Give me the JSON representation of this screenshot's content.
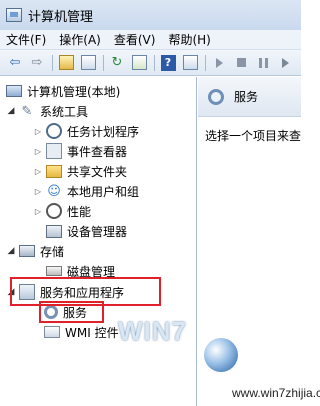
{
  "window": {
    "title": "计算机管理"
  },
  "menu": [
    "文件(F)",
    "操作(A)",
    "查看(V)",
    "帮助(H)"
  ],
  "toolbar": {
    "back": "⇦",
    "forward": "⇨",
    "refresh": "↻",
    "help": "?"
  },
  "tree": {
    "root": "计算机管理(本地)",
    "system_tools": "系统工具",
    "task_scheduler": "任务计划程序",
    "event_viewer": "事件查看器",
    "shared_folders": "共享文件夹",
    "local_users": "本地用户和组",
    "performance": "性能",
    "device_manager": "设备管理器",
    "storage": "存储",
    "disk_management": "磁盘管理",
    "services_apps": "服务和应用程序",
    "services": "服务",
    "wmi": "WMI 控件"
  },
  "right": {
    "title": "服务",
    "description": "选择一个项目来查"
  },
  "watermark": {
    "brand": "WIN7",
    "site": "www.win7zhijia.cn"
  }
}
